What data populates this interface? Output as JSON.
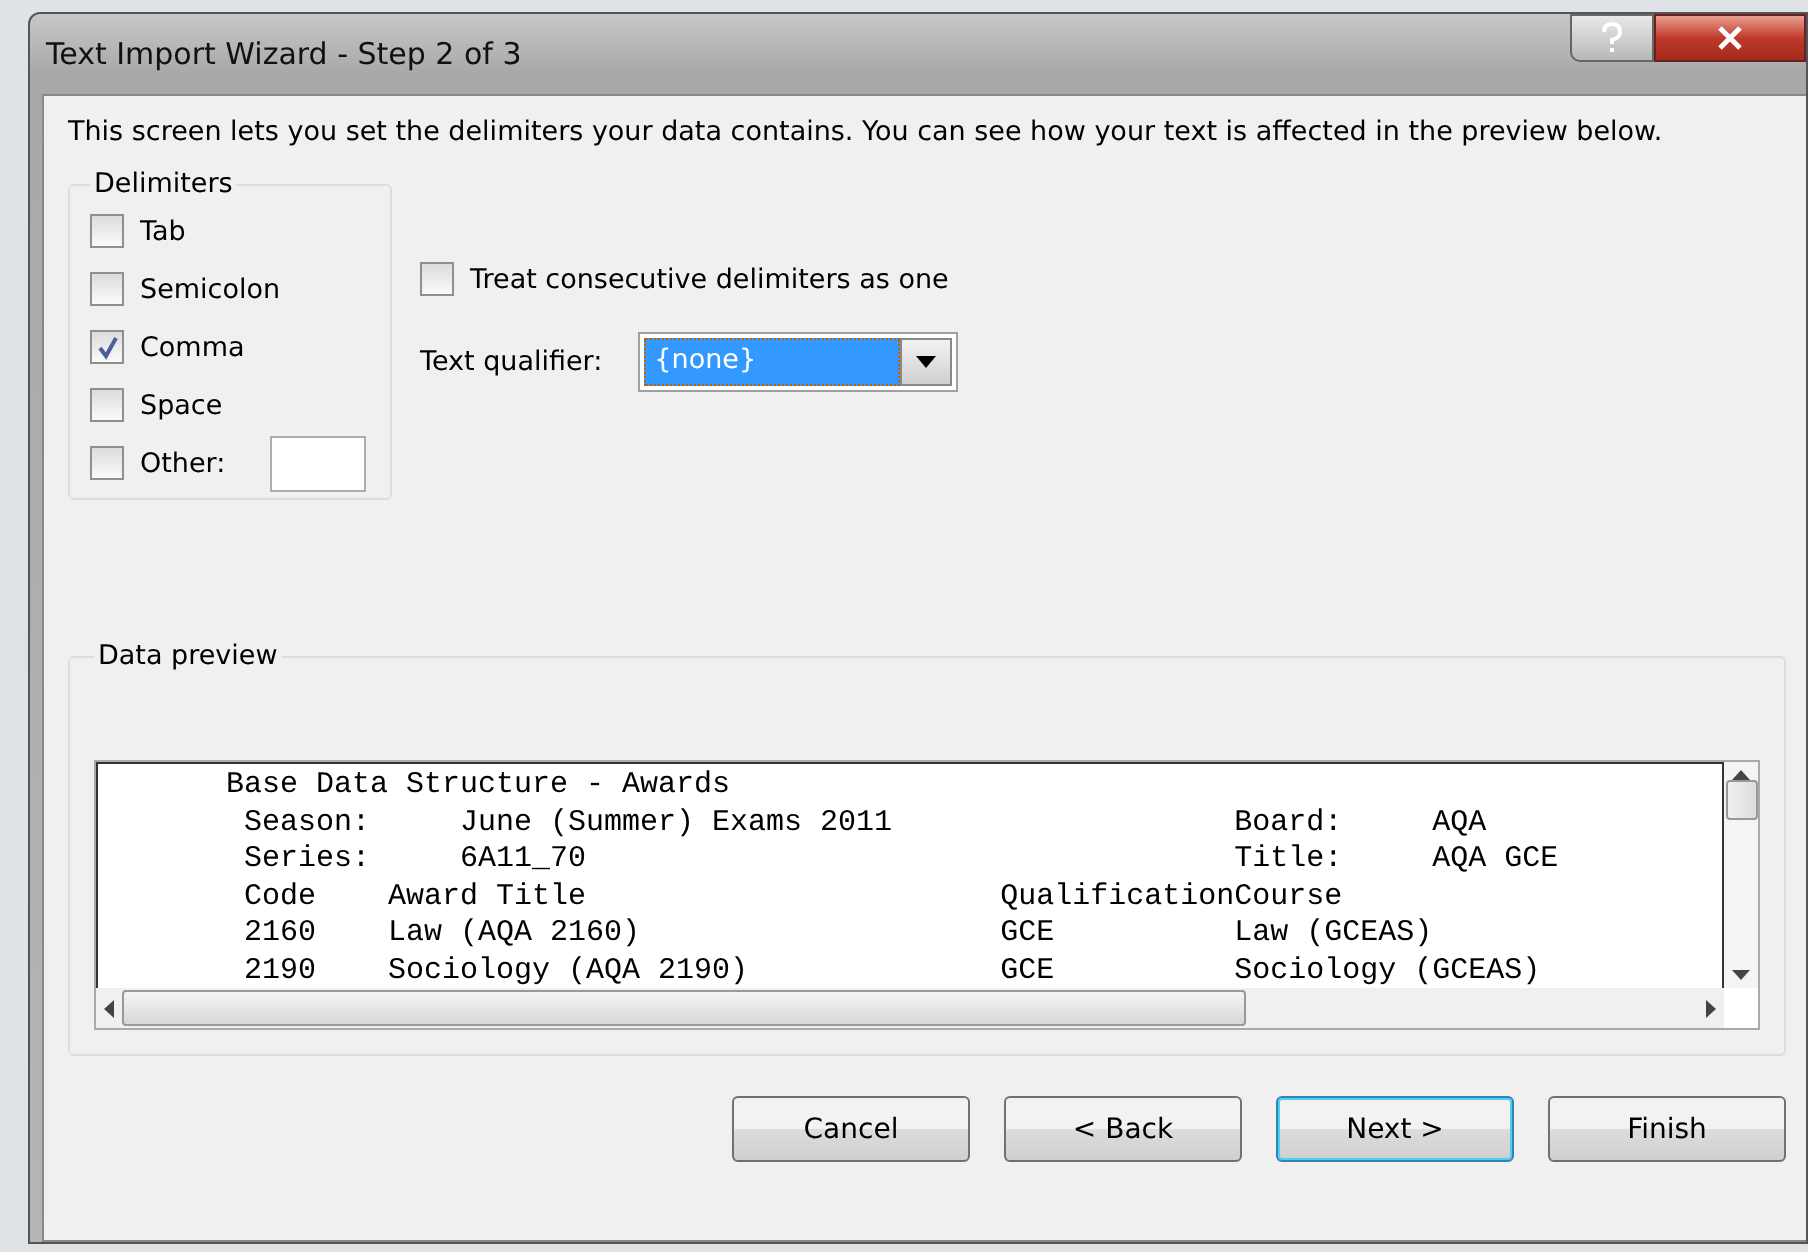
{
  "window": {
    "title": "Text Import Wizard - Step 2 of 3"
  },
  "description": "This screen lets you set the delimiters your data contains.  You can see how your text is affected in the preview below.",
  "delimiters": {
    "label": "Delimiters",
    "items": [
      {
        "label": "Tab",
        "checked": false
      },
      {
        "label": "Semicolon",
        "checked": false
      },
      {
        "label": "Comma",
        "checked": true
      },
      {
        "label": "Space",
        "checked": false
      },
      {
        "label": "Other:",
        "checked": false
      }
    ]
  },
  "consecutive": {
    "label": "Treat consecutive delimiters as one",
    "checked": false
  },
  "text_qualifier": {
    "label": "Text qualifier:",
    "value": "{none}"
  },
  "preview": {
    "label": "Data preview",
    "lines": [
      "      Base Data Structure - Awards",
      "       Season:     June (Summer) Exams 2011                   Board:     AQA",
      "       Series:     6A11_70                                    Title:     AQA GCE",
      "       Code    Award Title                       QualificationCourse",
      "       2160    Law (AQA 2160)                    GCE          Law (GCEAS)",
      "       2190    Sociology (AQA 2190)              GCE          Sociology (GCEAS)"
    ]
  },
  "buttons": [
    {
      "label": "Cancel",
      "default": false
    },
    {
      "label": "< Back",
      "default": false
    },
    {
      "label": "Next >",
      "default": true
    },
    {
      "label": "Finish",
      "default": false
    }
  ]
}
